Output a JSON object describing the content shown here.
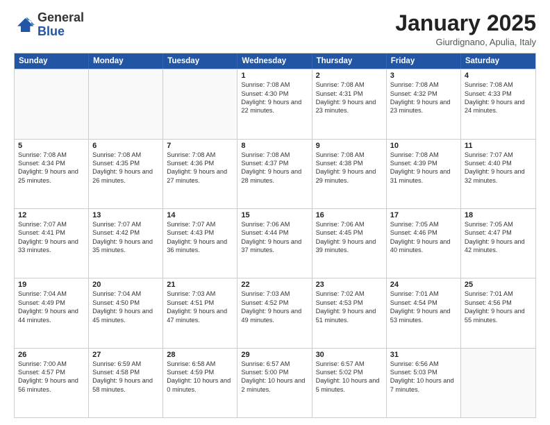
{
  "logo": {
    "general": "General",
    "blue": "Blue"
  },
  "header": {
    "month": "January 2025",
    "location": "Giurdignano, Apulia, Italy"
  },
  "days": [
    "Sunday",
    "Monday",
    "Tuesday",
    "Wednesday",
    "Thursday",
    "Friday",
    "Saturday"
  ],
  "rows": [
    [
      {
        "day": "",
        "empty": true
      },
      {
        "day": "",
        "empty": true
      },
      {
        "day": "",
        "empty": true
      },
      {
        "day": "1",
        "sunrise": "7:08 AM",
        "sunset": "4:30 PM",
        "daylight": "9 hours and 22 minutes."
      },
      {
        "day": "2",
        "sunrise": "7:08 AM",
        "sunset": "4:31 PM",
        "daylight": "9 hours and 23 minutes."
      },
      {
        "day": "3",
        "sunrise": "7:08 AM",
        "sunset": "4:32 PM",
        "daylight": "9 hours and 23 minutes."
      },
      {
        "day": "4",
        "sunrise": "7:08 AM",
        "sunset": "4:33 PM",
        "daylight": "9 hours and 24 minutes."
      }
    ],
    [
      {
        "day": "5",
        "sunrise": "7:08 AM",
        "sunset": "4:34 PM",
        "daylight": "9 hours and 25 minutes."
      },
      {
        "day": "6",
        "sunrise": "7:08 AM",
        "sunset": "4:35 PM",
        "daylight": "9 hours and 26 minutes."
      },
      {
        "day": "7",
        "sunrise": "7:08 AM",
        "sunset": "4:36 PM",
        "daylight": "9 hours and 27 minutes."
      },
      {
        "day": "8",
        "sunrise": "7:08 AM",
        "sunset": "4:37 PM",
        "daylight": "9 hours and 28 minutes."
      },
      {
        "day": "9",
        "sunrise": "7:08 AM",
        "sunset": "4:38 PM",
        "daylight": "9 hours and 29 minutes."
      },
      {
        "day": "10",
        "sunrise": "7:08 AM",
        "sunset": "4:39 PM",
        "daylight": "9 hours and 31 minutes."
      },
      {
        "day": "11",
        "sunrise": "7:07 AM",
        "sunset": "4:40 PM",
        "daylight": "9 hours and 32 minutes."
      }
    ],
    [
      {
        "day": "12",
        "sunrise": "7:07 AM",
        "sunset": "4:41 PM",
        "daylight": "9 hours and 33 minutes."
      },
      {
        "day": "13",
        "sunrise": "7:07 AM",
        "sunset": "4:42 PM",
        "daylight": "9 hours and 35 minutes."
      },
      {
        "day": "14",
        "sunrise": "7:07 AM",
        "sunset": "4:43 PM",
        "daylight": "9 hours and 36 minutes."
      },
      {
        "day": "15",
        "sunrise": "7:06 AM",
        "sunset": "4:44 PM",
        "daylight": "9 hours and 37 minutes."
      },
      {
        "day": "16",
        "sunrise": "7:06 AM",
        "sunset": "4:45 PM",
        "daylight": "9 hours and 39 minutes."
      },
      {
        "day": "17",
        "sunrise": "7:05 AM",
        "sunset": "4:46 PM",
        "daylight": "9 hours and 40 minutes."
      },
      {
        "day": "18",
        "sunrise": "7:05 AM",
        "sunset": "4:47 PM",
        "daylight": "9 hours and 42 minutes."
      }
    ],
    [
      {
        "day": "19",
        "sunrise": "7:04 AM",
        "sunset": "4:49 PM",
        "daylight": "9 hours and 44 minutes."
      },
      {
        "day": "20",
        "sunrise": "7:04 AM",
        "sunset": "4:50 PM",
        "daylight": "9 hours and 45 minutes."
      },
      {
        "day": "21",
        "sunrise": "7:03 AM",
        "sunset": "4:51 PM",
        "daylight": "9 hours and 47 minutes."
      },
      {
        "day": "22",
        "sunrise": "7:03 AM",
        "sunset": "4:52 PM",
        "daylight": "9 hours and 49 minutes."
      },
      {
        "day": "23",
        "sunrise": "7:02 AM",
        "sunset": "4:53 PM",
        "daylight": "9 hours and 51 minutes."
      },
      {
        "day": "24",
        "sunrise": "7:01 AM",
        "sunset": "4:54 PM",
        "daylight": "9 hours and 53 minutes."
      },
      {
        "day": "25",
        "sunrise": "7:01 AM",
        "sunset": "4:56 PM",
        "daylight": "9 hours and 55 minutes."
      }
    ],
    [
      {
        "day": "26",
        "sunrise": "7:00 AM",
        "sunset": "4:57 PM",
        "daylight": "9 hours and 56 minutes."
      },
      {
        "day": "27",
        "sunrise": "6:59 AM",
        "sunset": "4:58 PM",
        "daylight": "9 hours and 58 minutes."
      },
      {
        "day": "28",
        "sunrise": "6:58 AM",
        "sunset": "4:59 PM",
        "daylight": "10 hours and 0 minutes."
      },
      {
        "day": "29",
        "sunrise": "6:57 AM",
        "sunset": "5:00 PM",
        "daylight": "10 hours and 2 minutes."
      },
      {
        "day": "30",
        "sunrise": "6:57 AM",
        "sunset": "5:02 PM",
        "daylight": "10 hours and 5 minutes."
      },
      {
        "day": "31",
        "sunrise": "6:56 AM",
        "sunset": "5:03 PM",
        "daylight": "10 hours and 7 minutes."
      },
      {
        "day": "",
        "empty": true
      }
    ]
  ]
}
